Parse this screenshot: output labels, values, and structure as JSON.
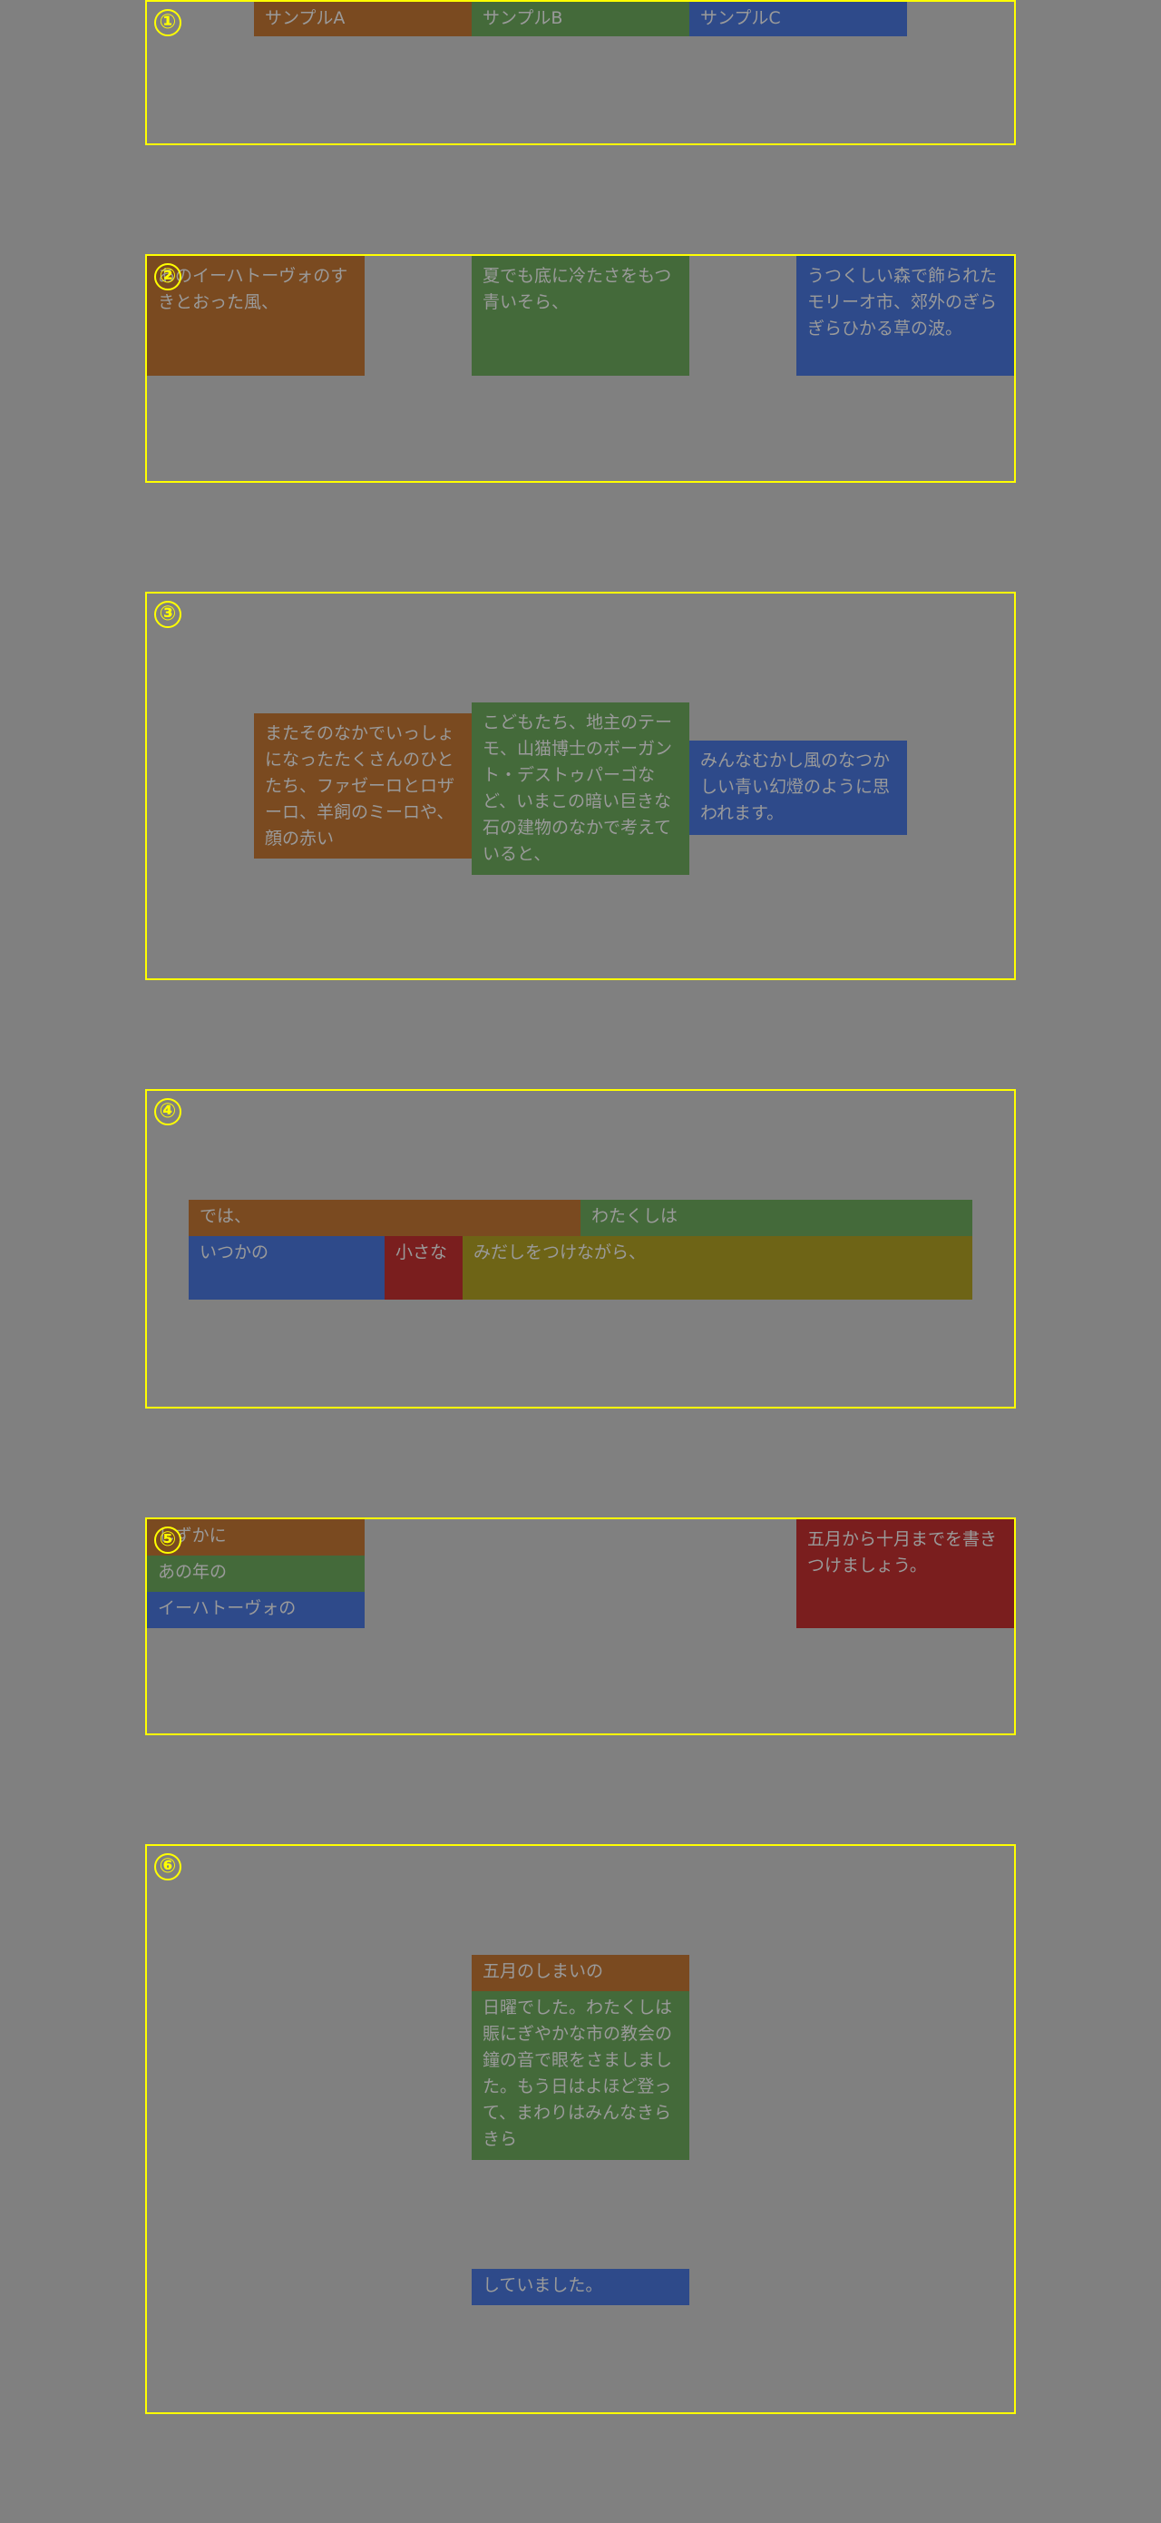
{
  "colors": {
    "background": "#808080",
    "frame": "#ffff00",
    "orange": "#7a4a20",
    "green": "#446a3a",
    "blue": "#2e4a8a",
    "red": "#7a1e1e",
    "olive": "#6e6416",
    "text": "#9a9a9a"
  },
  "sections": [
    {
      "number": "①",
      "boxes": [
        "サンプルA",
        "サンプルB",
        "サンプルC"
      ]
    },
    {
      "number": "②",
      "boxes": [
        "あのイーハトーヴォのすきとおった風、",
        "夏でも底に冷たさをもつ青いそら、",
        "うつくしい森で飾られたモリーオ市、郊外のぎらぎらひかる草の波。"
      ]
    },
    {
      "number": "③",
      "boxes": [
        "またそのなかでいっしょになったたくさんのひとたち、ファゼーロとロザーロ、羊飼のミーロや、顔の赤い",
        "こどもたち、地主のテーモ、山猫博士のボーガント・デストゥパーゴなど、いまこの暗い巨きな石の建物のなかで考えていると、",
        "みんなむかし風のなつかしい青い幻燈のように思われます。"
      ]
    },
    {
      "number": "④",
      "boxes": [
        "では、",
        "わたくしは",
        "いつかの",
        "小さな",
        "みだしをつけながら、"
      ]
    },
    {
      "number": "⑤",
      "boxes": [
        "しずかに",
        "あの年の",
        "イーハトーヴォの",
        "五月から十月までを書きつけましょう。"
      ]
    },
    {
      "number": "⑥",
      "boxes": [
        "五月のしまいの",
        "日曜でした。わたくしは賑にぎやかな市の教会の鐘の音で眼をさましました。もう日はよほど登って、まわりはみんなきらきら",
        "していました。"
      ]
    }
  ]
}
